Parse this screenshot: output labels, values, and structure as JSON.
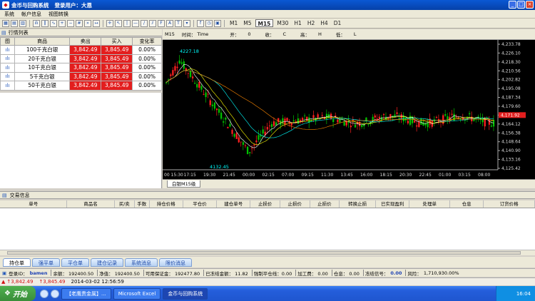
{
  "window": {
    "title": "金币与回购系统",
    "user": "登录用户：大恩",
    "buttons": [
      "_",
      "□",
      "×"
    ]
  },
  "menu": [
    "系统",
    "帐户信息",
    "视图转换"
  ],
  "toolbar": {
    "timeframes": [
      "M1",
      "M5",
      "M15",
      "M30",
      "H1",
      "H2",
      "H4",
      "D1"
    ],
    "active_timeframe": "M15"
  },
  "market_watch": {
    "title": "行情列表",
    "columns": [
      "图",
      "商品",
      "卖出",
      "买入",
      "变化率"
    ],
    "rows": [
      {
        "icon": "ılı",
        "name": "100千克白银",
        "sell": "3,842.49",
        "buy": "3,845.49",
        "change": "0.00%"
      },
      {
        "icon": "ılı",
        "name": "20千克白银",
        "sell": "3,842.49",
        "buy": "3,845.49",
        "change": "0.00%"
      },
      {
        "icon": "ılı",
        "name": "10千克白银",
        "sell": "3,842.49",
        "buy": "3,845.49",
        "change": "0.00%"
      },
      {
        "icon": "ılı",
        "name": "5千克白银",
        "sell": "3,842.49",
        "buy": "3,845.49",
        "change": "0.00%"
      },
      {
        "icon": "ılı",
        "name": "50千克白银",
        "sell": "3,842.49",
        "buy": "3,845.49",
        "change": "0.00%"
      }
    ]
  },
  "chart_header": {
    "period": "M15",
    "time_label": "时间：",
    "time_value": "Time",
    "open_label": "开：",
    "open_value": "0",
    "close_label": "收：",
    "close_value": "C",
    "high_label": "高：",
    "high_value": "H",
    "low_label": "低：",
    "low_value": "L"
  },
  "chart_data": {
    "type": "candlestick",
    "title": "",
    "annotations": [
      "4227.18",
      "4132.45"
    ],
    "price_ticks": [
      "4,233.78",
      "4,226.10",
      "4,218.30",
      "4,210.56",
      "4,202.82",
      "4,195.08",
      "4,187.34",
      "4,179.60",
      "4,171.92",
      "4,164.12",
      "4,156.38",
      "4,148.64",
      "4,140.90",
      "4,133.16",
      "4,125.42"
    ],
    "price_range": [
      4125.42,
      4233.78
    ],
    "current_price": "4,171.92",
    "time_ticks": [
      "00 15:30",
      "17:15",
      "19:30",
      "21:45",
      "00:00",
      "02:15",
      "07:00",
      "09:15",
      "11:30",
      "13:45",
      "16:00",
      "18:15",
      "20:30",
      "22:45",
      "01:00",
      "03:15",
      "08:00"
    ],
    "ma_colors": [
      "#ffffff",
      "#ffff00",
      "#00ffff",
      "#ff8800"
    ],
    "candle_up_color": "#00c000",
    "candle_down_color": "#ff2020"
  },
  "chart_tab": "白银M15级",
  "trade": {
    "title": "交易信息",
    "columns": [
      "单号",
      "商品名",
      "买/卖",
      "手数",
      "持仓价格",
      "平仓价",
      "建仓单号",
      "止损价",
      "止损价",
      "止损价",
      "转换止损",
      "已实现盈利",
      "处理单",
      "仓息",
      "订货价格"
    ]
  },
  "bottom_tabs": [
    "持仓单",
    "强平单",
    "平仓单",
    "建仓记录",
    "系统消息",
    "限价消息"
  ],
  "account": {
    "id_label": "登录ID：",
    "id_value": "bamen",
    "balance": "余额： 192400.50",
    "equity": "净值： 192400.50",
    "used_margin": "可用保证金： 192477.80",
    "frozen": "已冻结金额： 11.82",
    "margin_cut": "强制平仓线：0.00",
    "fee": "加工费： 0.00",
    "storage": "仓息： 0.00",
    "risk_label": "冻结信号：",
    "risk_value": "0.00",
    "ratio": "风险：",
    "ratio_value": "1,710,930.00%"
  },
  "ticker": {
    "symbol": "↑3,842.49",
    "symbol2": "↑3,845.49",
    "datetime": "2014-03-02 12:56:59"
  },
  "taskbar": {
    "start": "开始",
    "tasks": [
      "【老鹰贵金属】...",
      "Microsoft Excel",
      "金币与回购系统"
    ],
    "clock": "16:04"
  }
}
